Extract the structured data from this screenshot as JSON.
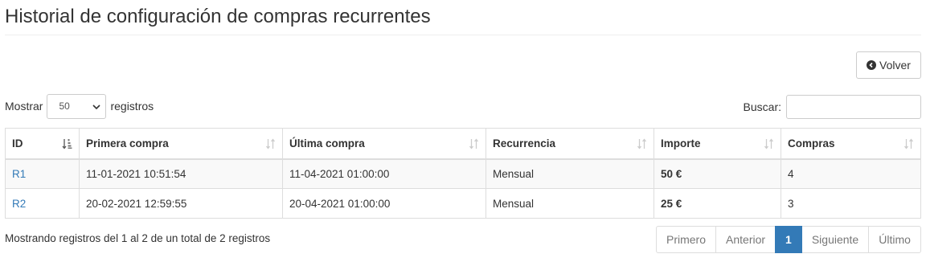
{
  "page": {
    "title": "Historial de configuración de compras recurrentes"
  },
  "toolbar": {
    "back_label": "Volver"
  },
  "length": {
    "prefix": "Mostrar",
    "value": "50",
    "suffix": "registros"
  },
  "search": {
    "label": "Buscar:",
    "value": ""
  },
  "table": {
    "columns": [
      "ID",
      "Primera compra",
      "Última compra",
      "Recurrencia",
      "Importe",
      "Compras"
    ],
    "rows": [
      {
        "id": "R1",
        "first": "11-01-2021 10:51:54",
        "last": "11-04-2021 01:00:00",
        "recurrence": "Mensual",
        "amount": "50 €",
        "purchases": "4"
      },
      {
        "id": "R2",
        "first": "20-02-2021 12:59:55",
        "last": "20-04-2021 01:00:00",
        "recurrence": "Mensual",
        "amount": "25 €",
        "purchases": "3"
      }
    ]
  },
  "info": "Mostrando registros del 1 al 2 de un total de 2 registros",
  "pagination": {
    "first": "Primero",
    "previous": "Anterior",
    "current": "1",
    "next": "Siguiente",
    "last": "Último"
  },
  "colors": {
    "link": "#337ab7",
    "active": "#337ab7",
    "border": "#dddddd"
  },
  "icons": {
    "back": "chevron-circle-left-icon",
    "sort": "sort-arrows-icon",
    "sort_active": "sort-numeric-asc-icon",
    "select": "chevron-down-icon"
  }
}
